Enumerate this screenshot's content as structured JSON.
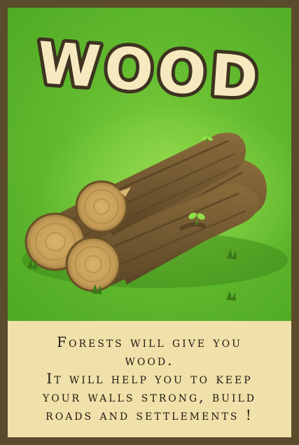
{
  "card": {
    "title": "WOOD",
    "description_lines": [
      "Forests will give you",
      "wood.",
      "It will help you to keep",
      "your walls strong, build",
      "roads and settlements !"
    ]
  },
  "colors": {
    "frame": "#5a4b2c",
    "grass": "#62bb2e",
    "caption_bg": "#f0e0a9",
    "title_fill": "#f6e9bf",
    "title_stroke": "#3d3320",
    "log_bark": "#7a5f33",
    "log_end": "#c9a15b"
  },
  "icons": [
    "wood-logs-illustration",
    "sprout-icon",
    "grass-tuft-icon"
  ]
}
